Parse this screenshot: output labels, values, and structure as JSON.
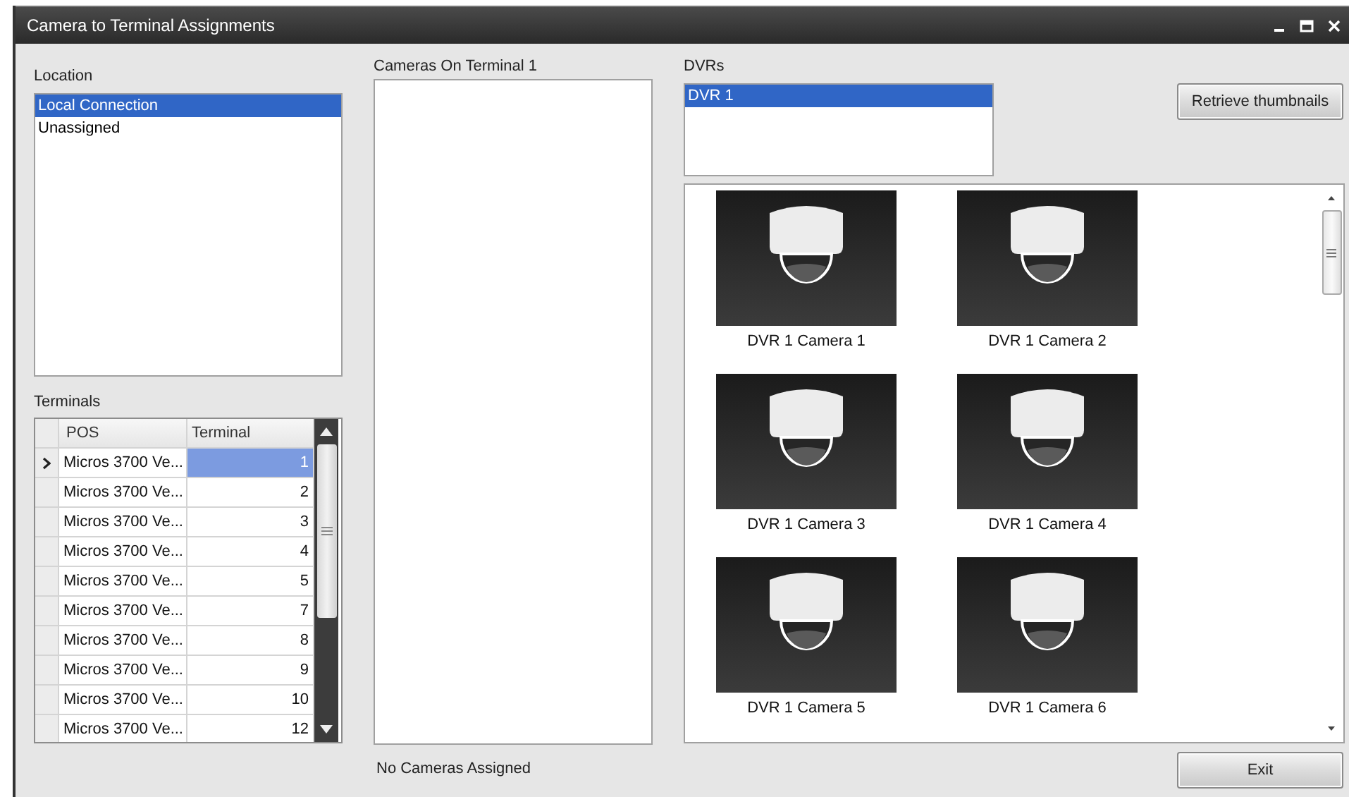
{
  "window": {
    "title": "Camera to Terminal Assignments"
  },
  "location": {
    "label": "Location",
    "items": [
      {
        "text": "Local Connection",
        "selected": true
      },
      {
        "text": "Unassigned",
        "selected": false
      }
    ]
  },
  "terminals": {
    "label": "Terminals",
    "columns": [
      "POS",
      "Terminal"
    ],
    "rows": [
      {
        "pos": "Micros 3700 Ve...",
        "terminal": "1",
        "selected": true
      },
      {
        "pos": "Micros 3700 Ve...",
        "terminal": "2",
        "selected": false
      },
      {
        "pos": "Micros 3700 Ve...",
        "terminal": "3",
        "selected": false
      },
      {
        "pos": "Micros 3700 Ve...",
        "terminal": "4",
        "selected": false
      },
      {
        "pos": "Micros 3700 Ve...",
        "terminal": "5",
        "selected": false
      },
      {
        "pos": "Micros 3700 Ve...",
        "terminal": "7",
        "selected": false
      },
      {
        "pos": "Micros 3700 Ve...",
        "terminal": "8",
        "selected": false
      },
      {
        "pos": "Micros 3700 Ve...",
        "terminal": "9",
        "selected": false
      },
      {
        "pos": "Micros 3700 Ve...",
        "terminal": "10",
        "selected": false
      },
      {
        "pos": "Micros 3700 Ve...",
        "terminal": "12",
        "selected": false
      }
    ]
  },
  "cameras_on_terminal": {
    "label": "Cameras On Terminal 1",
    "status": "No Cameras Assigned"
  },
  "dvrs": {
    "label": "DVRs",
    "items": [
      {
        "text": "DVR 1",
        "selected": true
      }
    ]
  },
  "retrieve_button": "Retrieve thumbnails",
  "thumbnails": [
    {
      "label": "DVR 1 Camera 1"
    },
    {
      "label": "DVR 1 Camera 2"
    },
    {
      "label": "DVR 1 Camera 3"
    },
    {
      "label": "DVR 1 Camera 4"
    },
    {
      "label": "DVR 1 Camera 5"
    },
    {
      "label": "DVR 1 Camera 6"
    }
  ],
  "exit_button": "Exit"
}
